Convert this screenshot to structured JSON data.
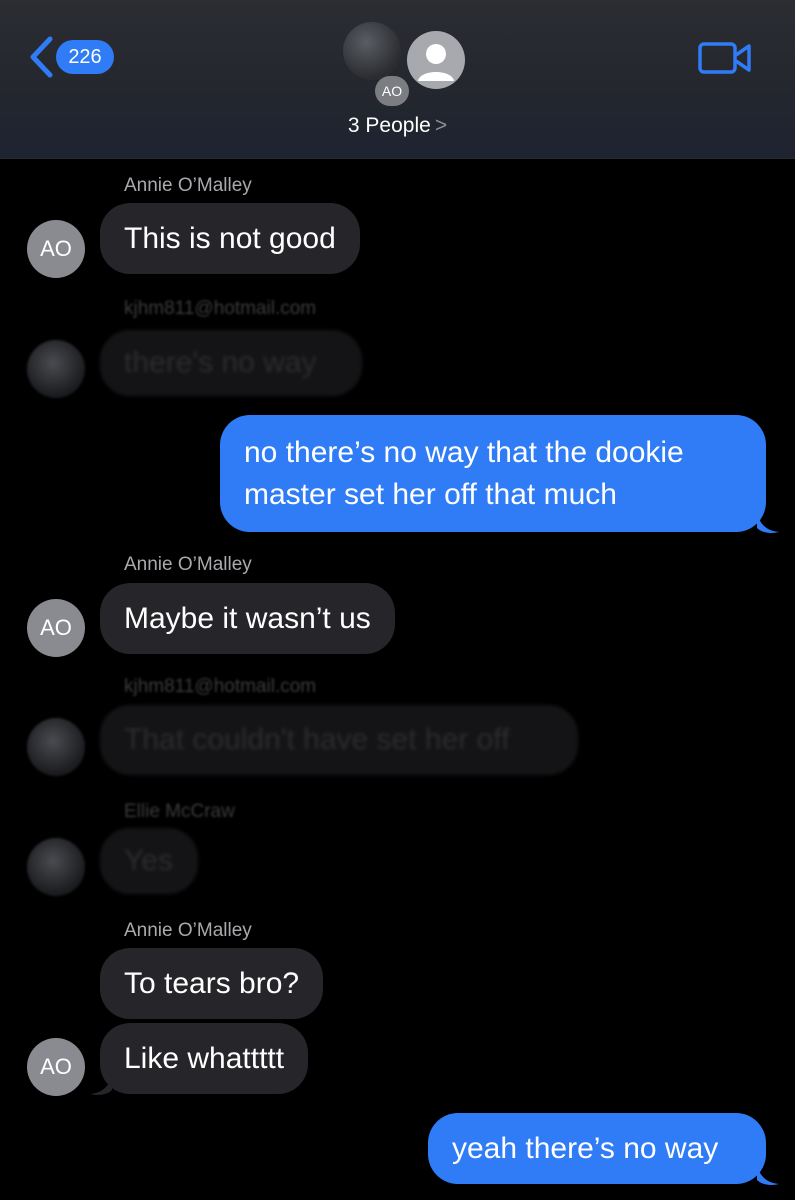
{
  "header": {
    "back_count": "226",
    "group_avatar_initials": "AO",
    "people_label": "3 People",
    "people_chevron": ">"
  },
  "messages": [
    {
      "sender": "Annie O’Malley",
      "avatar": "AO",
      "text": "This is not good"
    },
    {
      "sender": "kjhm811@hotmail.com",
      "text": "there's no way"
    },
    {
      "text": "no there’s no way that the dookie master set her off that much"
    },
    {
      "sender": "Annie O’Malley",
      "avatar": "AO",
      "text": "Maybe it wasn’t us"
    },
    {
      "sender": "kjhm811@hotmail.com",
      "text": "That couldn't have set her off"
    },
    {
      "sender": "Ellie McCraw",
      "text": "Yes"
    },
    {
      "sender": "Annie O’Malley",
      "text": "To tears bro?"
    },
    {
      "avatar": "AO",
      "text": "Like whattttt"
    },
    {
      "text": "yeah there’s no way"
    }
  ],
  "colors": {
    "sent_bubble": "#2f7cf6",
    "received_bubble": "#26262a",
    "background": "#000000"
  }
}
